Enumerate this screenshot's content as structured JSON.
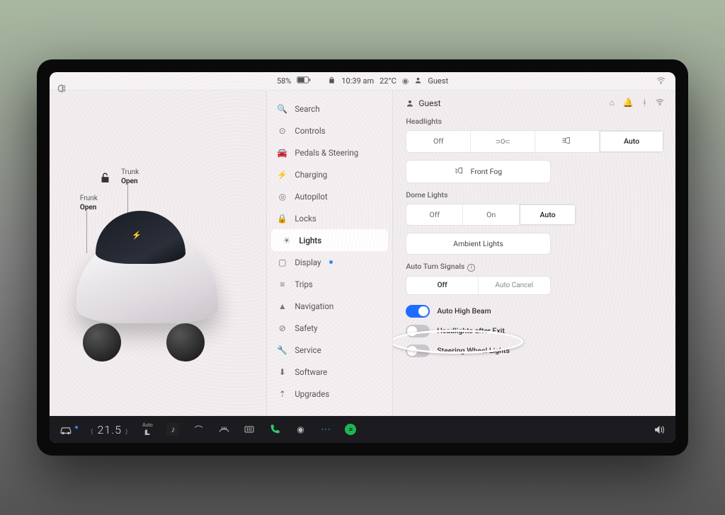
{
  "statusbar": {
    "battery_pct": "58%",
    "time": "10:39 am",
    "temp": "22°C",
    "profile": "Guest"
  },
  "car": {
    "frunk_label": "Frunk",
    "frunk_state": "Open",
    "trunk_label": "Trunk",
    "trunk_state": "Open"
  },
  "nav": {
    "search": "Search",
    "controls": "Controls",
    "pedals": "Pedals & Steering",
    "charging": "Charging",
    "autopilot": "Autopilot",
    "locks": "Locks",
    "lights": "Lights",
    "display": "Display",
    "trips": "Trips",
    "navigation": "Navigation",
    "safety": "Safety",
    "service": "Service",
    "software": "Software",
    "upgrades": "Upgrades"
  },
  "detail": {
    "profile": "Guest",
    "headlights_label": "Headlights",
    "headlights": {
      "off": "Off",
      "auto": "Auto"
    },
    "front_fog": "Front Fog",
    "dome_label": "Dome Lights",
    "dome": {
      "off": "Off",
      "on": "On",
      "auto": "Auto"
    },
    "ambient": "Ambient Lights",
    "auto_turn_label": "Auto Turn Signals",
    "auto_turn": {
      "off": "Off",
      "cancel": "Auto Cancel"
    },
    "auto_high_beam": "Auto High Beam",
    "headlights_after_exit": "Headlights after Exit",
    "steering_wheel_lights": "Steering Wheel Lights"
  },
  "dock": {
    "temp_setting": "21.5",
    "seat_auto": "Auto"
  }
}
